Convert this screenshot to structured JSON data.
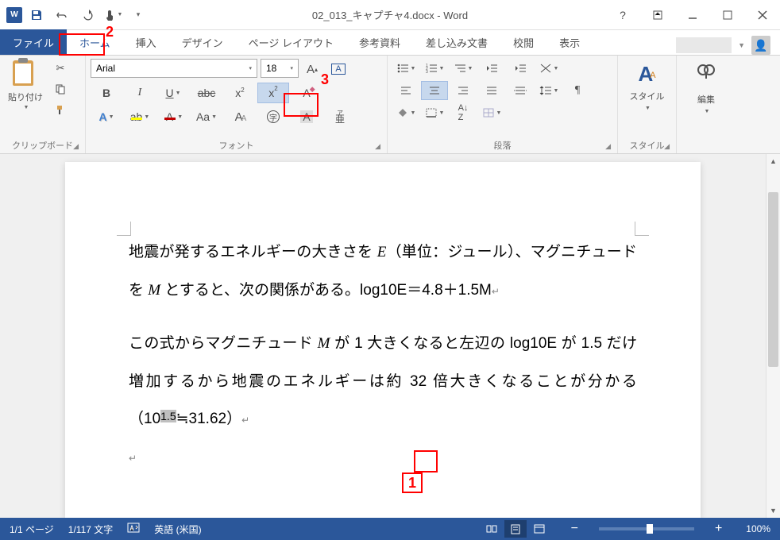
{
  "title": "02_013_キャプチャ4.docx - Word",
  "tabs": {
    "file": "ファイル",
    "home": "ホーム",
    "insert": "挿入",
    "design": "デザイン",
    "layout": "ページ レイアウト",
    "references": "参考資料",
    "mailings": "差し込み文書",
    "review": "校閲",
    "view": "表示"
  },
  "ribbon": {
    "clipboard": {
      "label": "クリップボード",
      "paste": "貼り付け"
    },
    "font": {
      "label": "フォント",
      "name": "Arial",
      "size": "18"
    },
    "paragraph": {
      "label": "段落"
    },
    "styles": {
      "label": "スタイル",
      "btn": "スタイル"
    },
    "editing": {
      "label": "編集",
      "btn": "編集"
    }
  },
  "document": {
    "p1a": "地震が発するエネルギーの大きさを ",
    "p1b": "E",
    "p1c": "（単位：ジュール）、マグニチュードを ",
    "p1d": "M",
    "p1e": " とすると、次の関係がある。log10E＝4.8＋1.5M",
    "p2a": "この式からマグニチュード ",
    "p2b": "M",
    "p2c": " が 1 大きくなると左辺の log10E が 1.5 だけ増加するから地震のエネルギーは約 32 倍大きくなることが分かる（10",
    "p2_exp": "1.5",
    "p2d": "≒31.62）"
  },
  "status": {
    "page": "1/1 ページ",
    "words": "1/117 文字",
    "lang": "英語 (米国)",
    "zoom": "100%"
  },
  "callouts": {
    "c1": "1",
    "c2": "2",
    "c3": "3"
  }
}
